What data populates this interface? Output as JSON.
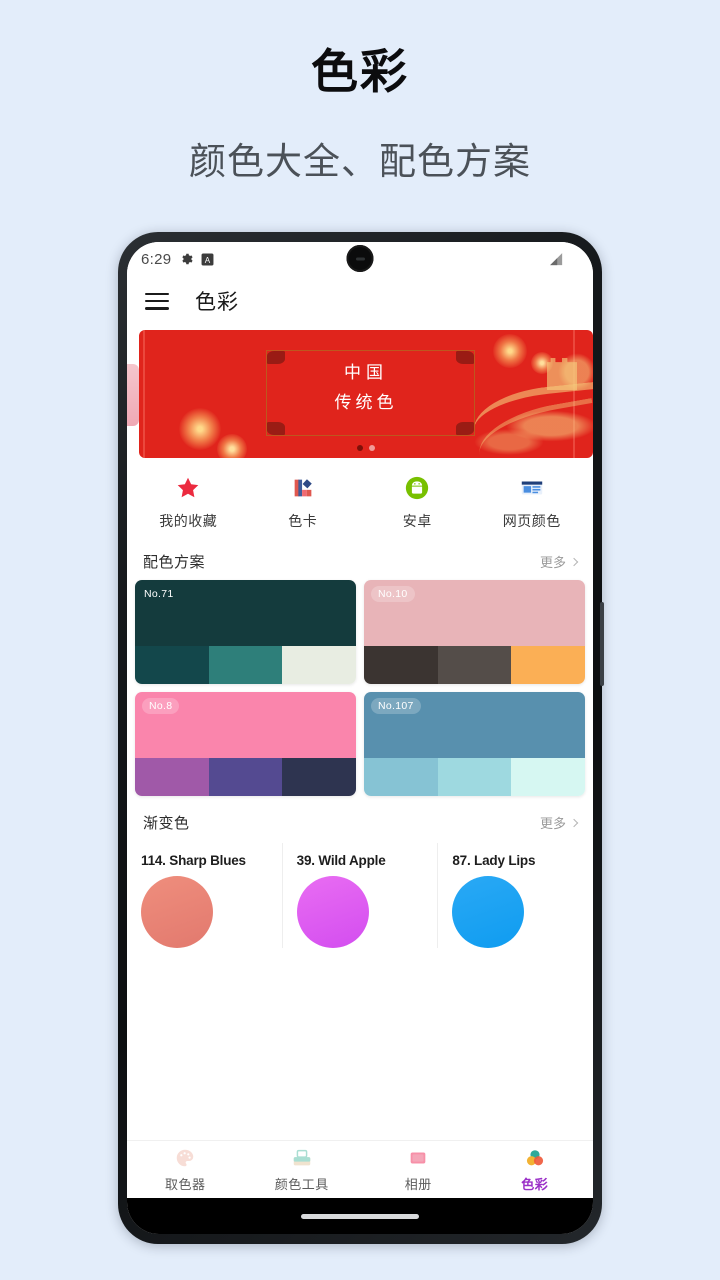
{
  "promo": {
    "title": "色彩",
    "subtitle": "颜色大全、配色方案",
    "bg_color": "#e3edfa"
  },
  "status_bar": {
    "time": "6:29",
    "icons": [
      "gear-icon",
      "a-badge-icon"
    ],
    "right_icon": "signal-icon"
  },
  "app_bar": {
    "menu_icon": "hamburger-menu-icon",
    "title": "色彩"
  },
  "banner": {
    "line1": "中国",
    "line2": "传统色",
    "bg_color": "#e0241c",
    "dots": 2,
    "active_dot": 0
  },
  "quick_actions": [
    {
      "label": "我的收藏",
      "icon": "star-icon"
    },
    {
      "label": "色卡",
      "icon": "color-card-icon"
    },
    {
      "label": "安卓",
      "icon": "android-icon"
    },
    {
      "label": "网页颜色",
      "icon": "web-page-icon"
    }
  ],
  "sections": {
    "palettes": {
      "title": "配色方案",
      "more": "更多",
      "items": [
        {
          "badge": "No.71",
          "badge_style": "plain",
          "main": "#143b3d",
          "strip": [
            "#13474b",
            "#2e7f7a",
            "#e8ede2"
          ]
        },
        {
          "badge": "No.10",
          "badge_style": "pill",
          "main": "#e8b4b8",
          "strip": [
            "#3b3431",
            "#544d49",
            "#fbaf55"
          ]
        },
        {
          "badge": "No.8",
          "badge_style": "pill",
          "main": "#fa85ac",
          "strip": [
            "#a059a8",
            "#544a91",
            "#2e3450"
          ]
        },
        {
          "badge": "No.107",
          "badge_style": "pill",
          "main": "#5890ae",
          "strip": [
            "#86c3d4",
            "#9ed9e0",
            "#d6f7f2"
          ]
        }
      ]
    },
    "gradients": {
      "title": "渐变色",
      "more": "更多",
      "items": [
        {
          "name": "114. Sharp Blues",
          "from": "#e2796e",
          "to": "#ef8e7d"
        },
        {
          "name": "39. Wild Apple",
          "from": "#d34df0",
          "to": "#e96df2"
        },
        {
          "name": "87. Lady Lips",
          "from": "#0f9cf0",
          "to": "#2aa9f5"
        }
      ]
    }
  },
  "bottom_nav": {
    "items": [
      {
        "label": "取色器",
        "icon": "palette-icon",
        "active": false
      },
      {
        "label": "颜色工具",
        "icon": "toolbox-icon",
        "active": false
      },
      {
        "label": "相册",
        "icon": "album-icon",
        "active": false
      },
      {
        "label": "色彩",
        "icon": "color-circles-icon",
        "active": true
      }
    ],
    "active_color": "#9b30c8"
  }
}
